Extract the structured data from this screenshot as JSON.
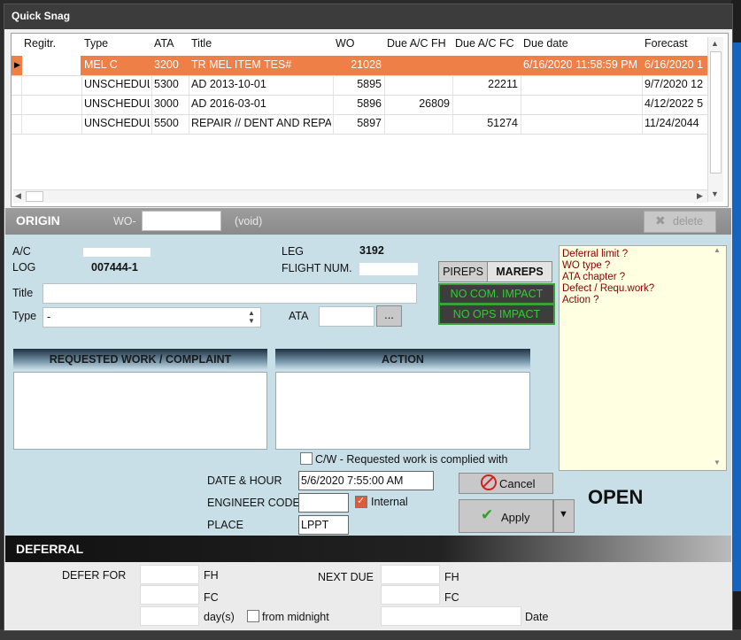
{
  "window": {
    "title": "Quick Snag"
  },
  "grid": {
    "columns": [
      "Regitr.",
      "Type",
      "ATA",
      "Title",
      "WO",
      "Due A/C FH",
      "Due A/C FC",
      "Due date",
      "Forecast"
    ],
    "rows": [
      {
        "regitr": "",
        "type": "MEL C",
        "ata": "3200",
        "title": "TR MEL ITEM TES#",
        "wo": "21028",
        "due_fh": "",
        "due_fc": "",
        "due_date": "6/16/2020 11:58:59 PM",
        "forecast": "6/16/2020 1",
        "selected": true
      },
      {
        "regitr": "",
        "type": "UNSCHEDUL",
        "ata": "5300",
        "title": "AD 2013-10-01",
        "wo": "5895",
        "due_fh": "",
        "due_fc": "22211",
        "due_date": "",
        "forecast": "9/7/2020 12",
        "selected": false
      },
      {
        "regitr": "",
        "type": "UNSCHEDUL",
        "ata": "3000",
        "title": "AD 2016-03-01",
        "wo": "5896",
        "due_fh": "26809",
        "due_fc": "",
        "due_date": "",
        "forecast": "4/12/2022 5",
        "selected": false
      },
      {
        "regitr": "",
        "type": "UNSCHEDUL",
        "ata": "5500",
        "title": "REPAIR // DENT AND REPAI",
        "wo": "5897",
        "due_fh": "",
        "due_fc": "51274",
        "due_date": "",
        "forecast": "11/24/2044",
        "selected": false
      }
    ]
  },
  "origin": {
    "title": "ORIGIN",
    "wo_label": "WO-",
    "wo_value": "",
    "void_label": "(void)",
    "delete_label": "delete"
  },
  "form": {
    "ac_label": "A/C",
    "ac_value": "",
    "log_label": "LOG",
    "log_value": "007444-1",
    "leg_label": "LEG",
    "leg_value": "3192",
    "flight_label": "FLIGHT NUM.",
    "flight_value": "",
    "title_label": "Title",
    "title_value": "",
    "type_label": "Type",
    "type_value": "-",
    "ata_label": "ATA",
    "ata_value": "",
    "ata_button": "...",
    "pireps_label": "PIREPS",
    "mareps_label": "MAREPS",
    "com_impact": "NO COM. IMPACT",
    "ops_impact": "NO OPS IMPACT",
    "requested_header": "REQUESTED WORK / COMPLAINT",
    "action_header": "ACTION",
    "requested_value": "",
    "action_value": "",
    "cw_label": "C/W - Requested work is complied with",
    "date_label": "DATE & HOUR",
    "date_value": "5/6/2020 7:55:00 AM",
    "engineer_label": "ENGINEER CODE",
    "engineer_value": "",
    "internal_label": "Internal",
    "place_label": "PLACE",
    "place_value": "LPPT",
    "cancel_label": "Cancel",
    "apply_label": "Apply",
    "status": "OPEN"
  },
  "notes": [
    "Deferral limit ?",
    "WO type ?",
    "ATA chapter ?",
    "Defect / Requ.work?",
    "Action ?"
  ],
  "deferral": {
    "title": "DEFERRAL",
    "defer_for_label": "DEFER FOR",
    "fh_label": "FH",
    "fc_label": "FC",
    "days_label": "day(s)",
    "from_midnight_label": "from midnight",
    "next_due_label": "NEXT DUE",
    "next_fh_label": "FH",
    "next_fc_label": "FC",
    "date_label": "Date"
  },
  "colors": {
    "selected_row": "#ee7f47",
    "panel": "#c9dfe8",
    "impact_text": "#2fcf2f",
    "notes_bg": "#ffffe1"
  }
}
